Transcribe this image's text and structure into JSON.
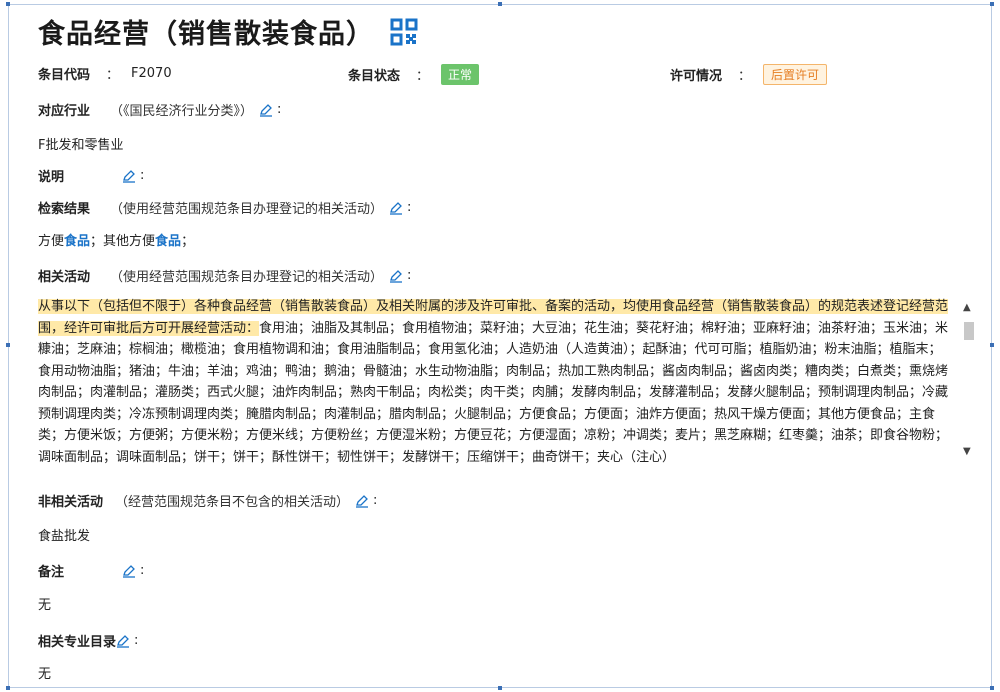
{
  "title": "食品经营（销售散装食品）",
  "meta": {
    "code_label": "条目代码",
    "code_value": "F2070",
    "status_label": "条目状态",
    "status_value": "正常",
    "license_label": "许可情况",
    "license_value": "后置许可"
  },
  "colon": "：",
  "edit_colon": ":",
  "industry": {
    "label": "对应行业",
    "hint": "（《国民经济行业分类》）",
    "value": "F批发和零售业"
  },
  "description": {
    "label": "说明"
  },
  "search": {
    "label": "检索结果",
    "hint": "（使用经营范围规范条目办理登记的相关活动）",
    "value_pre": "方便",
    "value_kw1": "食品",
    "value_mid": "；其他方便",
    "value_kw2": "食品",
    "value_post": "；"
  },
  "related": {
    "label": "相关活动",
    "hint": "（使用经营范围规范条目办理登记的相关活动）",
    "highlight": "从事以下（包括但不限于）各种食品经营（销售散装食品）及相关附属的涉及许可审批、备案的活动，均使用食品经营（销售散装食品）的规范表述登记经营范围，经许可审批后方可开展经营活动：",
    "items": "食用油；油脂及其制品；食用植物油；菜籽油；大豆油；花生油；葵花籽油；棉籽油；亚麻籽油；油茶籽油；玉米油；米糠油；芝麻油；棕榈油；橄榄油；食用植物调和油；食用油脂制品；食用氢化油；人造奶油（人造黄油）；起酥油；代可可脂；植脂奶油；粉末油脂；植脂末；食用动物油脂；猪油；牛油；羊油；鸡油；鸭油；鹅油；骨髓油；水生动物油脂；肉制品；热加工熟肉制品；酱卤肉制品；酱卤肉类；糟肉类；白煮类；熏烧烤肉制品；肉灌制品；灌肠类；西式火腿；油炸肉制品；熟肉干制品；肉松类；肉干类；肉脯；发酵肉制品；发酵灌制品；发酵火腿制品；预制调理肉制品；冷藏预制调理肉类；冷冻预制调理肉类；腌腊肉制品；肉灌制品；腊肉制品；火腿制品；方便食品；方便面；油炸方便面；热风干燥方便面；其他方便食品；主食类；方便米饭；方便粥；方便米粉；方便米线；方便粉丝；方便湿米粉；方便豆花；方便湿面；凉粉；冲调类；麦片；黑芝麻糊；红枣羹；油茶；即食谷物粉；调味面制品；调味面制品；饼干；饼干；酥性饼干；韧性饼干；发酵饼干；压缩饼干；曲奇饼干；夹心（注心）"
  },
  "unrelated": {
    "label": "非相关活动",
    "hint": "（经营范围规范条目不包含的相关活动）",
    "value": "食盐批发"
  },
  "remark": {
    "label": "备注",
    "value": "无"
  },
  "catalog": {
    "label": "相关专业目录",
    "value": "无"
  },
  "colors": {
    "accent": "#1a73c8",
    "status_green": "#6cc46b",
    "license_orange": "#e67e22",
    "highlight": "#ffe9a8"
  },
  "icons": {
    "qr": "qr-code-icon",
    "edit": "edit-pencil-icon"
  }
}
